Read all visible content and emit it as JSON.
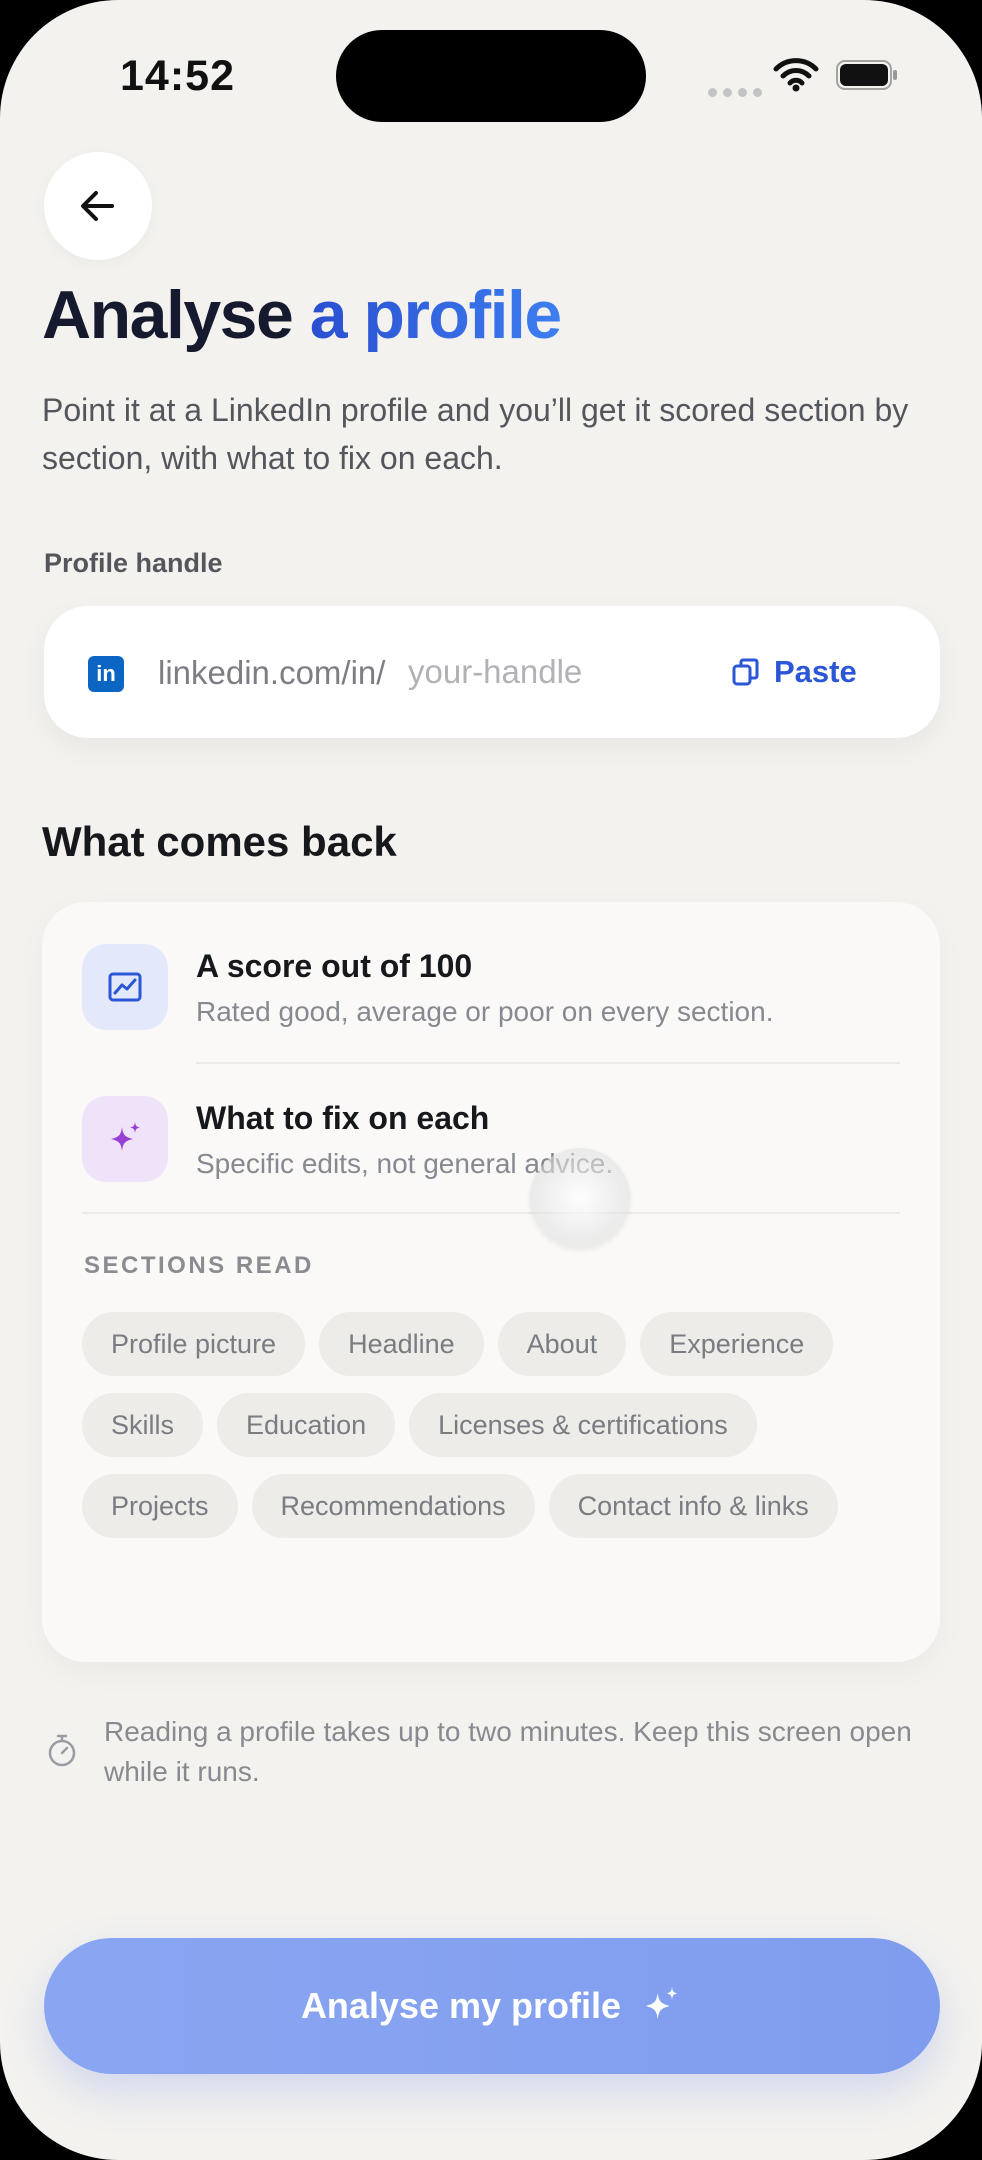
{
  "status_bar": {
    "time": "14:52"
  },
  "header": {
    "title_main": "Analyse",
    "title_accent": "a profile",
    "subtitle": "Point it at a LinkedIn profile and you’ll get it scored section by section, with what to fix on each."
  },
  "profile_field": {
    "label": "Profile handle",
    "brand_badge": "in",
    "prefix": "linkedin.com/in/",
    "placeholder": "your-handle",
    "value": "",
    "paste_label": "Paste"
  },
  "results": {
    "heading": "What comes back",
    "features": [
      {
        "title": "A score out of 100",
        "description": "Rated good, average or poor on every section.",
        "icon": "chart-icon"
      },
      {
        "title": "What to fix on each",
        "description": "Specific edits, not general advice.",
        "icon": "sparkle-icon"
      }
    ],
    "sections_label": "SECTIONS READ",
    "sections": [
      "Profile picture",
      "Headline",
      "About",
      "Experience",
      "Skills",
      "Education",
      "Licenses & certifications",
      "Projects",
      "Recommendations",
      "Contact info & links"
    ]
  },
  "note": "Reading a profile takes up to two minutes. Keep this screen open while it runs.",
  "cta": {
    "label": "Analyse my profile"
  },
  "colors": {
    "accent_blue": "#2b56d6",
    "linkedin_blue": "#0a66c2",
    "cta_blue": "#8aa6f2",
    "sparkle_purple": "#9a3fd6",
    "background": "#f3f2ef"
  }
}
